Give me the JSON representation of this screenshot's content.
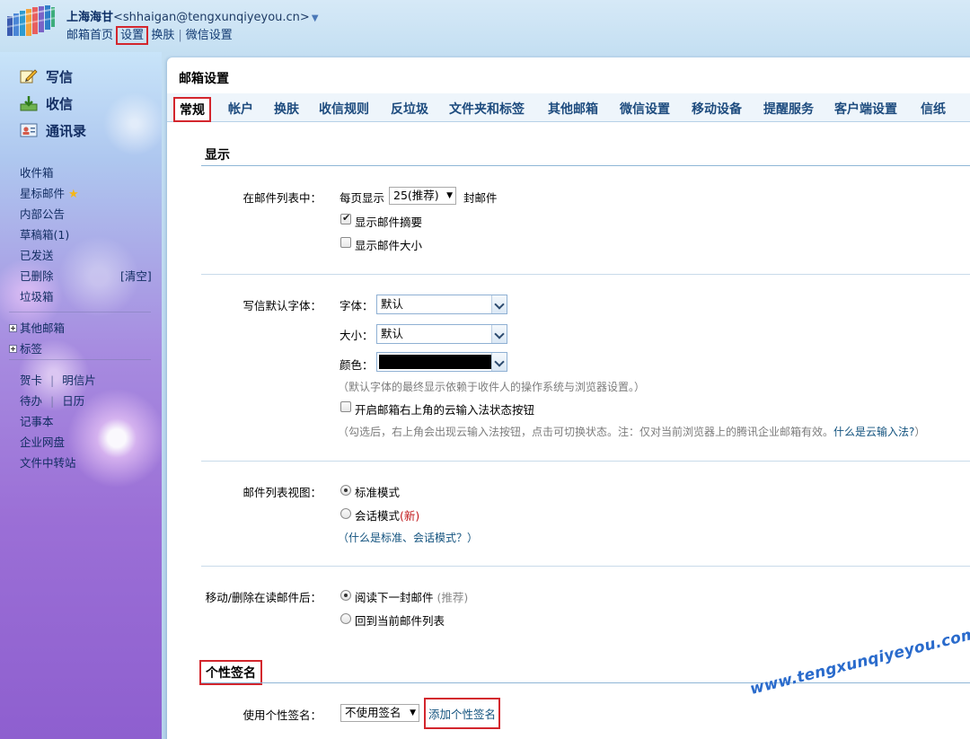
{
  "header": {
    "user_name": "上海海甘",
    "user_email": "<shhaigan@tengxunqiyeyou.cn>",
    "nav": {
      "home": "邮箱首页",
      "settings": "设置",
      "skin": "换肤",
      "wechat_settings": "微信设置"
    },
    "separator": "|"
  },
  "sidebar": {
    "write": "写信",
    "receive": "收信",
    "contacts": "通讯录",
    "folders": {
      "inbox": "收件箱",
      "starred": "星标邮件",
      "announcements": "内部公告",
      "drafts": "草稿箱(1)",
      "sent": "已发送",
      "deleted": "已删除",
      "deleted_clear": "[清空]",
      "spam": "垃圾箱"
    },
    "other_mail": "其他邮箱",
    "tags": "标签",
    "tools": {
      "card": "贺卡",
      "postcard": "明信片",
      "todo": "待办",
      "calendar": "日历",
      "notepad": "记事本",
      "netdisk": "企业网盘",
      "transfer": "文件中转站"
    }
  },
  "main": {
    "title": "邮箱设置",
    "tabs": [
      "常规",
      "帐户",
      "换肤",
      "收信规则",
      "反垃圾",
      "文件夹和标签",
      "其他邮箱",
      "微信设置",
      "移动设备",
      "提醒服务",
      "客户端设置",
      "信纸"
    ],
    "display_section": {
      "title": "显示",
      "list_label": "在邮件列表中：",
      "per_page_prefix": "每页显示",
      "per_page_value": "25(推荐)",
      "per_page_suffix": "封邮件",
      "show_summary": "显示邮件摘要",
      "show_summary_checked": true,
      "show_size": "显示邮件大小",
      "show_size_checked": false,
      "font_label": "写信默认字体：",
      "font_family_label": "字体：",
      "font_family_value": "默认",
      "font_size_label": "大小：",
      "font_size_value": "默认",
      "font_color_label": "颜色：",
      "font_color_value": "#000000",
      "font_hint": "（默认字体的最终显示依赖于收件人的操作系统与浏览器设置。）",
      "cloud_input": "开启邮箱右上角的云输入法状态按钮",
      "cloud_input_checked": false,
      "cloud_hint": "（勾选后，右上角会出现云输入法按钮，点击可切换状态。注：仅对当前浏览器上的腾讯企业邮箱有效。",
      "cloud_hint_link": "什么是云输入法?",
      "cloud_hint_end": "）",
      "view_label": "邮件列表视图：",
      "view_standard": "标准模式",
      "view_conversation": "会话模式",
      "view_new_tag": "(新)",
      "view_selected": "standard",
      "view_help_open": "（",
      "view_help_link": "什么是标准、会话模式？",
      "view_help_close": "）",
      "after_read_label": "移动/删除在读邮件后：",
      "after_read_next": "阅读下一封邮件",
      "after_read_next_hint": "(推荐)",
      "after_read_back": "回到当前邮件列表",
      "after_read_selected": "next"
    },
    "signature_section": {
      "title": "个性签名",
      "use_label": "使用个性签名：",
      "use_value": "不使用签名",
      "add_link": "添加个性签名"
    }
  },
  "watermark": "www.tengxunqiyeyou.com",
  "colors": {
    "highlight_border": "#d3262d",
    "link": "#12527e",
    "tab_text": "#1d4b7e",
    "watermark": "#2a6bcc"
  }
}
